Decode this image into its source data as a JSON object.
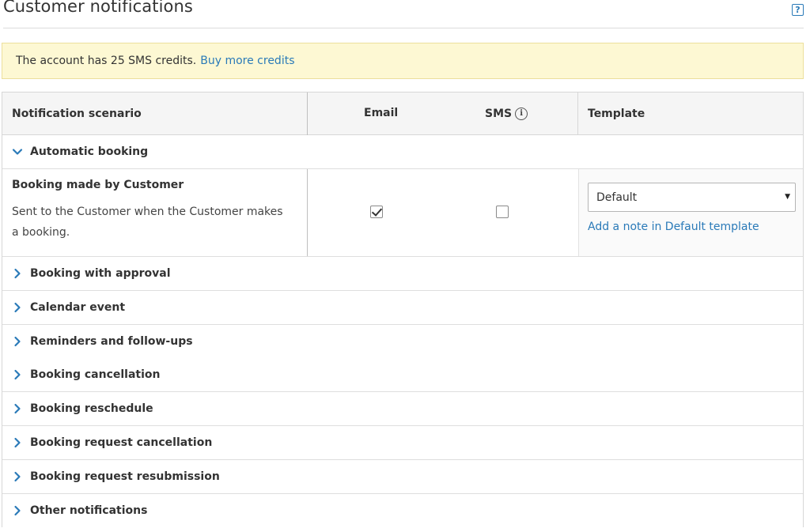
{
  "header": {
    "title": "Customer notifications",
    "help_glyph": "?"
  },
  "banner": {
    "text": "The account has 25 SMS credits.",
    "link": "Buy more credits"
  },
  "table": {
    "columns": {
      "scenario": "Notification scenario",
      "email": "Email",
      "sms": "SMS",
      "template": "Template"
    },
    "sms_info_glyph": "i",
    "expanded_group": {
      "label": "Automatic booking",
      "item": {
        "title": "Booking made by Customer",
        "description": "Sent to the Customer when the Customer makes a booking.",
        "email_checked": true,
        "sms_checked": false,
        "template_value": "Default",
        "template_link": "Add a note in Default template"
      }
    },
    "collapsed_groups": [
      "Booking with approval",
      "Calendar event",
      "Reminders and follow-ups",
      "Booking cancellation",
      "Booking reschedule",
      "Booking request cancellation",
      "Booking request resubmission",
      "Other notifications"
    ]
  },
  "colors": {
    "accent": "#2a7ab8",
    "banner_bg": "#fdf8d3",
    "header_bg": "#f5f5f5"
  }
}
